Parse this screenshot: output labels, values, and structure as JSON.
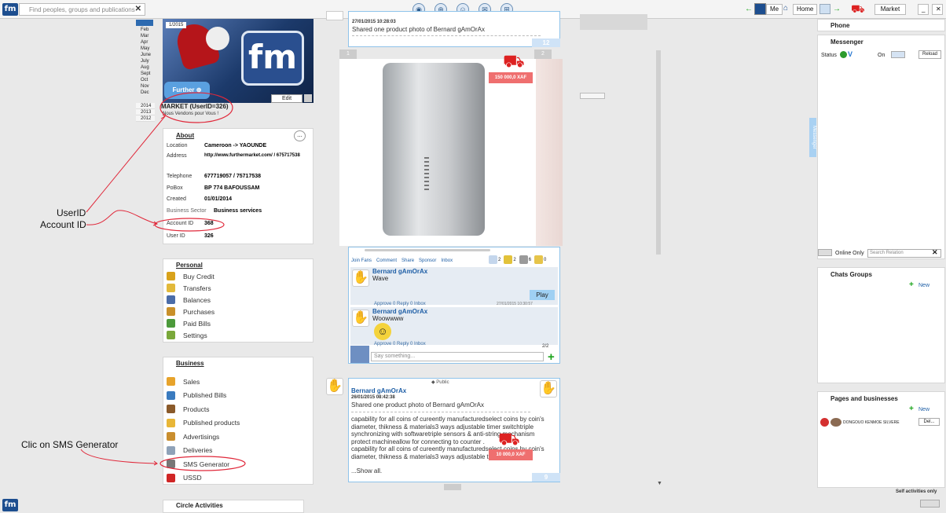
{
  "topbar": {
    "search_placeholder": "Find peoples, groups and publications",
    "search_clear": "✕",
    "me_label": "Me",
    "home_label": "Home",
    "market_label": "Market",
    "minimize": "_",
    "close": "✕"
  },
  "profile": {
    "banner_date": "1/2015",
    "edit_label": "Edit",
    "name": "MARKET (UserID=326)",
    "slogan": "Nous Vendons pour Vous !",
    "months": [
      "Feb",
      "Mar",
      "Apr",
      "May",
      "June",
      "July",
      "Aug",
      "Sept",
      "Oct",
      "Nov",
      "Dec"
    ],
    "years": [
      "2014",
      "2013",
      "2012"
    ]
  },
  "about": {
    "title": "About",
    "more": "...",
    "rows": [
      {
        "label": "Location",
        "value": "Cameroon -> YAOUNDE"
      },
      {
        "label": "Address",
        "value": "http://www.furthermarket.com/ / 675717538"
      },
      {
        "label": "Telephone",
        "value": "677719057 / 75717538"
      },
      {
        "label": "PoBox",
        "value": "BP 774 BAFOUSSAM"
      },
      {
        "label": "Created",
        "value": "01/01/2014"
      },
      {
        "label": "Business Sector",
        "value": "Business services"
      },
      {
        "label": "Account ID",
        "value": "368"
      },
      {
        "label": "User ID",
        "value": "326"
      }
    ]
  },
  "personal": {
    "title": "Personal",
    "items": [
      "Buy Credit",
      "Transfers",
      "Balances",
      "Purchases",
      "Paid Bills",
      "Settings"
    ]
  },
  "business": {
    "title": "Business",
    "items": [
      "Sales",
      "Published Bills",
      "Products",
      "Published products",
      "Advertisings",
      "Deliveries",
      "SMS Generator",
      "USSD"
    ]
  },
  "circle": {
    "title": "Circle Activities"
  },
  "annotations": {
    "userid": "UserID",
    "accountid": "Account ID",
    "sms": "Clic on SMS Generator"
  },
  "post1": {
    "date": "27/01/2015 10:28:03",
    "text": "Shared one product photo of  Bernard gAmOrAx",
    "count": "12",
    "img_num_left": "1",
    "img_num_right": "2",
    "price": "150 000,0 XAF",
    "actions": [
      "Join Fans",
      "Comment",
      "Share",
      "Sponsor",
      "Inbox"
    ],
    "stats": [
      "2",
      "2",
      "6",
      "0"
    ],
    "comments": [
      {
        "name": "Bernard gAmOrAx",
        "text": "Wave",
        "play": "Play",
        "meta": "Approve   0  Reply  0  Inbox",
        "date": "27/01/2015 10:30:57"
      },
      {
        "name": "Bernard gAmOrAx",
        "text": "Woowwww",
        "meta": "Approve   0  Reply  0  Inbox"
      }
    ],
    "page_count": "2/2",
    "say_placeholder": "Say something..."
  },
  "post2": {
    "public_label": "Public",
    "name": "Bernard gAmOrAx",
    "date": "26/01/2015 08:42:38",
    "text": "Shared one product photo of  Bernard gAmOrAx",
    "body": "capability for all coins of cureently manufacturedselect coins by coin's diameter, thikness & materials3 ways adjustable timer switchtriple synchronizing with softwaretriple sensors & anti-string mechanism protect machineallow for connecting to counter .\ncapability for all coins of cureently manufacturedselect coins by coin's diameter, thikness & materials3 ways adjustable timer switch",
    "show_all": "...Show all.",
    "price": "10 000,0 XAF",
    "count": "9"
  },
  "right": {
    "phone": "Phone",
    "messenger": "Messenger",
    "status_label": "Status",
    "on_label": "On",
    "reload": "Reload",
    "side_tab": "Messenger",
    "online_only": "Online Only",
    "search_relation": "Search Relation",
    "chats_groups": "Chats Groups",
    "new_label": "New",
    "pages_businesses": "Pages and businesses",
    "page_name": "DONGOUO KENMOE SILVERE",
    "del_label": "Del...",
    "self_activities": "Self activities only"
  },
  "colors": {
    "accent": "#1f5fa6",
    "annotation": "#e0283a",
    "price": "#ef6f6f"
  }
}
